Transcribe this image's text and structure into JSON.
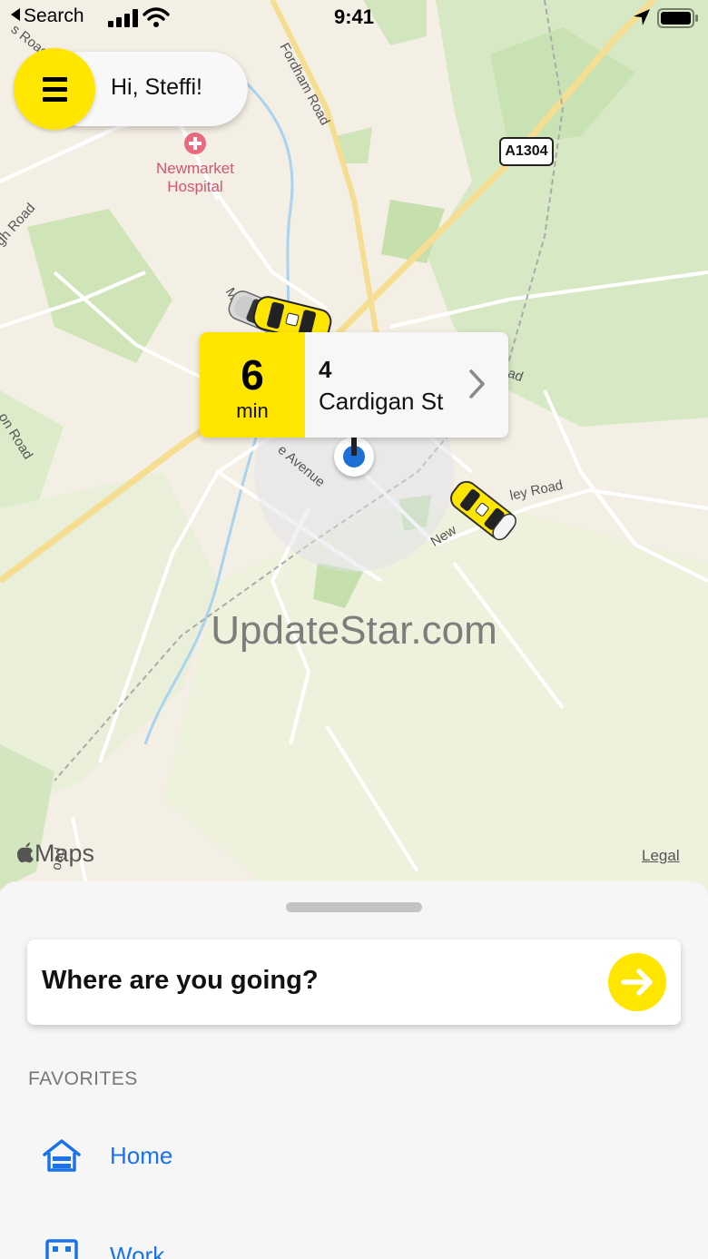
{
  "status_bar": {
    "back_label": "Search",
    "time": "9:41"
  },
  "header": {
    "greeting": "Hi, Steffi!"
  },
  "map": {
    "poi_name_line1": "Newmarket",
    "poi_name_line2": "Hospital",
    "road_labels": {
      "fordham": "Fordham Road",
      "mill": "Mill",
      "avenue": "e Avenue",
      "new": "New",
      "ley": "ley Road",
      "gh_road": "gh Road",
      "ton_road": "on Road",
      "s_road": "s Road",
      "ad": "ad",
      "oad": "oad"
    },
    "route_shield": "A1304",
    "attribution": "Maps",
    "legal": "Legal",
    "watermark": "UpdateStar.com"
  },
  "eta_card": {
    "minutes": "6",
    "unit": "min",
    "address_line1": "4",
    "address_line2": "Cardigan St"
  },
  "bottom_sheet": {
    "search_prompt": "Where are you going?",
    "favorites_heading": "FAVORITES",
    "favorites": [
      {
        "label": "Home",
        "icon": "home-icon"
      },
      {
        "label": "Work",
        "icon": "work-icon"
      }
    ]
  },
  "colors": {
    "accent": "#ffe600",
    "link": "#1a73e8",
    "pin": "#1d6fd6"
  }
}
